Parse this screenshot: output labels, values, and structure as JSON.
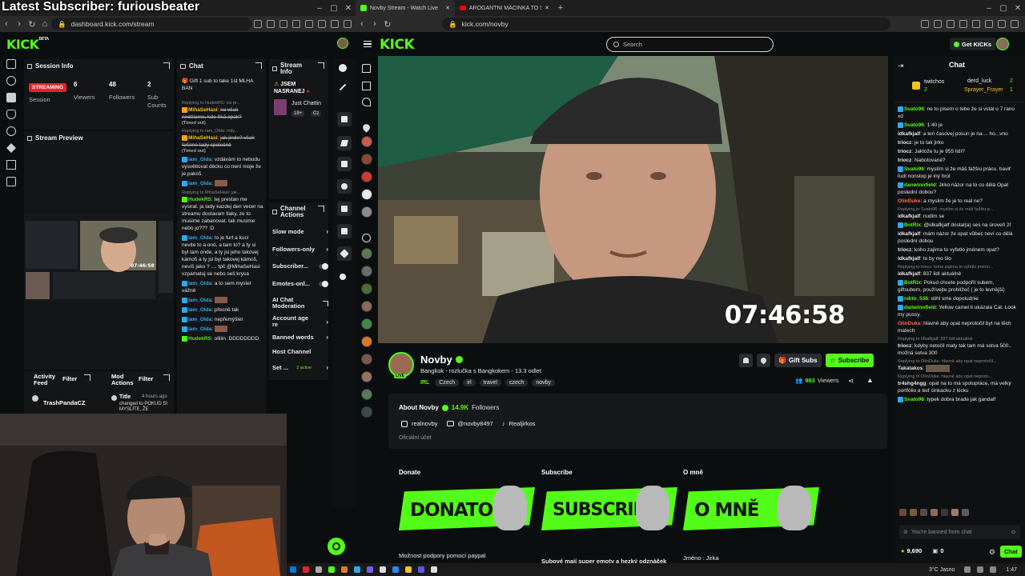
{
  "overlay": {
    "subscriber_banner": "Latest Subscriber: furiousbeater"
  },
  "left_browser": {
    "url": "dashboard.kick.com/stream",
    "logo": "KICK",
    "logo_badge": "BETA",
    "session_info": {
      "title": "Session Info",
      "status": "STREAMING",
      "session_label": "Session",
      "stats": [
        {
          "value": "6",
          "label": "Viewers"
        },
        {
          "value": "48",
          "label": "Followers"
        },
        {
          "value": "2",
          "label": "Sub Counts"
        }
      ]
    },
    "stream_preview": {
      "title": "Stream Preview"
    },
    "chat": {
      "title": "Chat",
      "pinned": "Gift 1 sub to take 1st MLHA BAN",
      "messages": [
        {
          "reply": "Replying to HudekRS: vis pr...",
          "user": "MihaSeHasi",
          "text": "no však nedělame, kdo říká opak?",
          "strike": true,
          "timedout": "(Timed out)",
          "color": "y"
        },
        {
          "reply": "Replying to Iam_Olda: mity...",
          "user": "MihaSeHasi",
          "text": "jak jinde? však řešíme tady společně",
          "strike": true,
          "timedout": "(Timed out)",
          "color": "y"
        },
        {
          "reply": "",
          "user": "Iam_Olda",
          "text": "vzdávám to nebudu vysvětlovat děcku co není moje že je pakoš",
          "strike": false,
          "timedout": "",
          "color": "b"
        },
        {
          "reply": "",
          "user": "Iam_Olda",
          "text": "",
          "strike": false,
          "timedout": "",
          "color": "b"
        },
        {
          "reply": "Replying to MihaSeHasi: jak...",
          "user": "HudekRS",
          "text": "tej prestan me vysirat. ja tady kazdej den vecer na streamu dostavam tlaky, ze to musime zabanovat. tak musime nebo jo??? :D",
          "strike": false,
          "timedout": "",
          "color": "g"
        },
        {
          "reply": "",
          "user": "Iam_Olda",
          "text": "to je furt a kuci nevite to a onó, a tam to? a ty sí byl tam onde, a ty jsi jeho takovej kámoš a ty jsi byi takovej kámoš, nevíš jako ? .... tpč @MihaSeHasi vzpamatuj se nebo seš krysa",
          "strike": false,
          "timedout": "",
          "color": "b"
        },
        {
          "reply": "",
          "user": "Iam_Olda",
          "text": "a to sem myslel vážně",
          "strike": false,
          "timedout": "",
          "color": "b"
        },
        {
          "reply": "",
          "user": "Iam_Olda",
          "text": "",
          "strike": false,
          "timedout": "",
          "color": "b"
        },
        {
          "reply": "",
          "user": "Iam_Olda",
          "text": "přesně tak",
          "strike": false,
          "timedout": "",
          "color": "b"
        },
        {
          "reply": "",
          "user": "Iam_Olda",
          "text": "nepřemýšlel",
          "strike": false,
          "timedout": "",
          "color": "b"
        },
        {
          "reply": "",
          "user": "Iam_Olda",
          "text": "",
          "strike": false,
          "timedout": "",
          "color": "b"
        },
        {
          "reply": "",
          "user": "HudekRS",
          "text": "olliiin :DDDDDDDD",
          "strike": false,
          "timedout": "",
          "color": "g"
        }
      ]
    },
    "stream_info": {
      "title": "Stream Info",
      "stream_title": "JSEM NASRANEJ",
      "category": "Just Chattin",
      "rating": "18+",
      "lang": "Cz"
    },
    "channel_actions": {
      "title": "Channel Actions",
      "items": [
        {
          "label": "Slow mode",
          "type": "chevron"
        },
        {
          "label": "Followers-only",
          "type": "chevron"
        },
        {
          "label": "Subscriber...",
          "type": "toggle"
        },
        {
          "label": "Emotes-onl...",
          "type": "toggle"
        },
        {
          "label": "AI Chat Moderation",
          "type": "external"
        },
        {
          "label": "Account age re",
          "type": "chevron"
        },
        {
          "label": "Banned words",
          "type": "chevron"
        },
        {
          "label": "Host Channel",
          "type": "none"
        },
        {
          "label": "Set ...",
          "type": "chevron",
          "extra": "2 active"
        }
      ]
    },
    "activity_feed": {
      "title": "Activity Feed",
      "filter": "Filter",
      "item_user": "TrashPandaCZ",
      "item_note": "ordered (Wrestle..."
    },
    "mod_actions": {
      "title": "Mod Actions",
      "filter": "Filter",
      "item_title": "Title",
      "item_time": "4 hours ago",
      "item_text": "changed to POKUD SI MYSLÍTE, ŽE"
    }
  },
  "right_browser": {
    "tabs": [
      {
        "label": "Novby Stream - Watch Live",
        "active": true
      },
      {
        "label": "AROGANTNÍ MACINKA TO SCHYTAL",
        "active": false
      }
    ],
    "url": "kick.com/novby",
    "logo": "KICK",
    "search_placeholder": "Search",
    "get_kicks": "Get KICKs",
    "video_timer": "07:46:58",
    "channel": {
      "name": "Novby",
      "title": "Bangkok - rozlučka s Bangkokem - 13.3 odlet",
      "category": "IRL",
      "tags": [
        "Czech",
        "irl",
        "travel",
        "czech",
        "novby"
      ],
      "viewers": "983",
      "viewers_label": "Viewers",
      "live": "LIVE",
      "gift_subs": "Gift Subs",
      "subscribe": "Subscribe"
    },
    "about": {
      "title": "About Novby",
      "followers": "14.9K",
      "followers_label": "Followers",
      "instagram": "realnovby",
      "youtube": "@novby8497",
      "tiktok": "Realjirkos",
      "official": "Oficiální účet"
    },
    "panels": [
      {
        "heading": "Donate",
        "banner": "DONATOSS",
        "desc": "Možnost podpory pomocí paypal"
      },
      {
        "heading": "Subscribe",
        "banner": "SUBSCRIBE",
        "desc": "Subové mají super emoty a hezký odznáček"
      },
      {
        "heading": "O mně",
        "banner": "O MNĚ",
        "desc": "Jméno : Jirka"
      }
    ],
    "chat": {
      "title": "Chat",
      "leaderboard": [
        {
          "user": "twitchos",
          "count": "2"
        },
        {
          "user": "derd_luck",
          "count": "2"
        },
        {
          "user": "Sprayer_Frayer",
          "count": "1"
        }
      ],
      "messages": [
        {
          "reply": "",
          "user": "Svato96",
          "text": "ne to pisem o tebe že si vstal o 7 rano xd",
          "color": "g"
        },
        {
          "reply": "",
          "user": "Svato96",
          "text": "1:40 je",
          "color": "g"
        },
        {
          "reply": "",
          "user": "idkafkjalf",
          "text": "a ten časovej posun je na.... ho...vno",
          "color": "p"
        },
        {
          "reply": "",
          "user": "triocz",
          "text": "je to tak jirko",
          "color": "p"
        },
        {
          "reply": "",
          "user": "triocz",
          "text": "Jaktože tu je 955 lidí?",
          "color": "p"
        },
        {
          "reply": "",
          "user": "triocz",
          "text": "Nabotované?",
          "color": "p"
        },
        {
          "reply": "",
          "user": "Svato96",
          "text": "myslím si že máš fažšiu prácu. baviť ľudí nonstop je iný hrot",
          "color": "g"
        },
        {
          "reply": "",
          "user": "danwinnfield",
          "text": "Jirko názor na to co dělá Opat poslední dobou?",
          "color": "g"
        },
        {
          "reply": "",
          "user": "OlinDuke",
          "text": "a myslim že je to real ne?",
          "color": "o"
        },
        {
          "reply": "Replying to Svato96: myslím si že máš fažšiu p...",
          "user": "idkafkjalf",
          "text": "nudim se",
          "color": "p"
        },
        {
          "reply": "",
          "user": "BotRix",
          "text": "@idkafkjalf dostal(a) ses na úroveň 2!",
          "color": "g"
        },
        {
          "reply": "",
          "user": "idkafkjalf",
          "text": "mám názor že opat vůbec neví co dělá poslední dobou",
          "color": "p"
        },
        {
          "reply": "",
          "user": "triocz",
          "text": "koho zajíma to vyfetlo jménem opat?",
          "color": "p"
        },
        {
          "reply": "",
          "user": "idkafkjalf",
          "text": "to by mo šlo",
          "color": "p"
        },
        {
          "reply": "Replying to triocz: koho zajíma to vyfetlo jméno...",
          "user": "idkafkjalf",
          "text": "837 lidí aktuálně",
          "color": "p"
        },
        {
          "reply": "",
          "user": "BotRix",
          "text": "Pokud chcete podpořit subem, giftsubem, používejte prohlížeč ( je to levnější)",
          "color": "g"
        },
        {
          "reply": "",
          "user": "nikto_536",
          "text": "stihl sme dopoludnie",
          "color": "g"
        },
        {
          "reply": "",
          "user": "danwinnfield",
          "text": "Yellow camel ti ukázala Cat. Look my pussy.",
          "color": "g"
        },
        {
          "reply": "",
          "user": "OlinDuke",
          "text": "hlavně aby opat neprotočil byt na těch matech",
          "color": "o"
        },
        {
          "reply": "Replying to idkafkjalf: 837 lidí aktuálně",
          "user": "triocz",
          "text": "kdyby netočil maty tak tam má sotva 500.. možná sotva 300",
          "color": "p"
        },
        {
          "reply": "Replying to OlinDuke: hlavně aby opat neprotočil...",
          "user": "Takatakos",
          "text": "",
          "color": "p"
        },
        {
          "reply": "Replying to OlinDuke: hlavně aby opat neproto...",
          "user": "tr4shg4ngg",
          "text": "opat na to má spolupráce, má velký portfólio a teď cinkacku z kicku",
          "color": "p"
        },
        {
          "reply": "",
          "user": "Svato96",
          "text": "typek dobra brade jak gandalf",
          "color": "g"
        }
      ],
      "input_placeholder": "You're banned from chat",
      "kicks_balance": "9,690",
      "other_balance": "0",
      "send_label": "Chat"
    }
  },
  "taskbar": {
    "weather": "3°C Jasno",
    "time": "1:47"
  },
  "colors": {
    "kick_green": "#53fc18",
    "streaming_red": "#e0242c",
    "bg": "#0b0e0f"
  }
}
